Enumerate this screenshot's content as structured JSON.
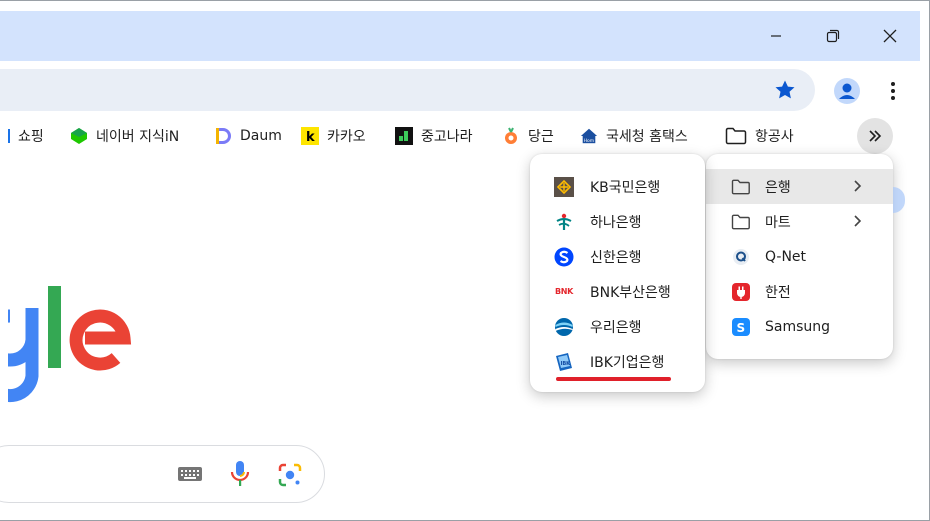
{
  "window": {
    "minimize": "minimize-icon",
    "restore": "restore-icon",
    "close": "close-icon"
  },
  "toolbar": {
    "star_icon": "bookmark-star-icon",
    "profile_icon": "profile-icon",
    "menu_icon": "more-vert-icon"
  },
  "bookmarks": [
    {
      "label": "쇼핑"
    },
    {
      "label": "네이버 지식iN"
    },
    {
      "label": "Daum"
    },
    {
      "label": "카카오"
    },
    {
      "label": "중고나라"
    },
    {
      "label": "당근"
    },
    {
      "label": "국세청 홈택스"
    },
    {
      "label": "항공사"
    }
  ],
  "overflow_menu": {
    "items": [
      {
        "label": "은행"
      },
      {
        "label": "마트"
      },
      {
        "label": "Q-Net"
      },
      {
        "label": "한전"
      },
      {
        "label": "Samsung"
      }
    ]
  },
  "bank_menu": {
    "items": [
      {
        "label": "KB국민은행"
      },
      {
        "label": "하나은행"
      },
      {
        "label": "신한은행"
      },
      {
        "label": "BNK부산은행",
        "icon_text": "BNK"
      },
      {
        "label": "우리은행"
      },
      {
        "label": "IBK기업은행"
      }
    ]
  },
  "colors": {
    "titlebar": "#d3e3fd",
    "omnibox": "#e9eef6",
    "accent": "#0b57d0",
    "underline": "#e0202a"
  }
}
